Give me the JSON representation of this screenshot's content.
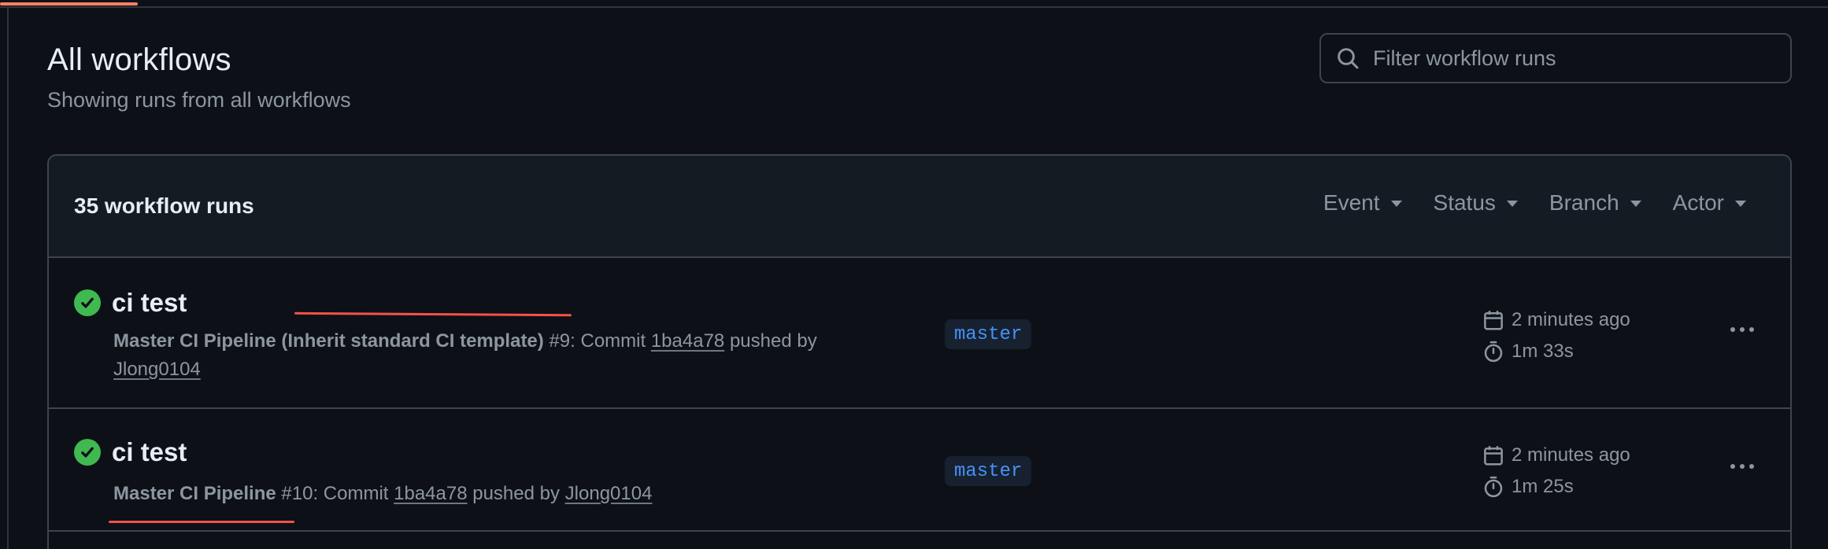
{
  "header": {
    "title": "All workflows",
    "subtitle": "Showing runs from all workflows"
  },
  "search": {
    "placeholder": "Filter workflow runs"
  },
  "runs_box": {
    "count_label": "35 workflow runs",
    "filters": [
      "Event",
      "Status",
      "Branch",
      "Actor"
    ]
  },
  "runs": [
    {
      "title": "ci test",
      "workflow": "Master CI Pipeline (Inherit standard CI template)",
      "run_number": "#9",
      "commit_prefix": ": Commit",
      "commit": "1ba4a78",
      "pushed_by": "pushed by",
      "actor": "Jlong0104",
      "branch": "master",
      "time_ago": "2 minutes ago",
      "duration": "1m 33s",
      "status": "success"
    },
    {
      "title": "ci test",
      "workflow": "Master CI Pipeline",
      "run_number": "#10",
      "commit_prefix": ": Commit",
      "commit": "1ba4a78",
      "pushed_by": "pushed by",
      "actor": "Jlong0104",
      "branch": "master",
      "time_ago": "2 minutes ago",
      "duration": "1m 25s",
      "status": "success"
    }
  ],
  "colors": {
    "background": "#0d1117",
    "success": "#3fb950",
    "branch_text": "#4493f8",
    "annotation": "#f85149",
    "accent": "#f78166"
  },
  "icons": [
    "search-icon",
    "check-circle-icon",
    "calendar-icon",
    "stopwatch-icon",
    "kebab-menu-icon",
    "caret-down-icon"
  ]
}
